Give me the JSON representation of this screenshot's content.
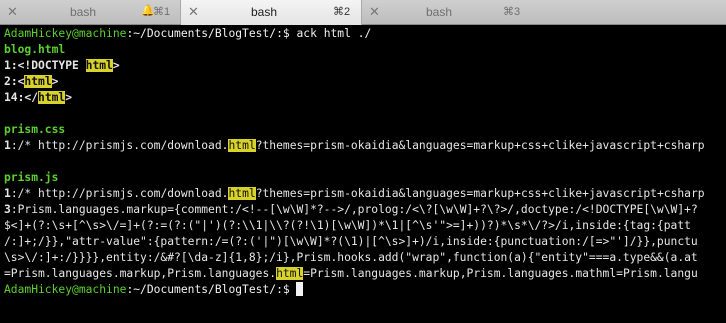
{
  "tabs": [
    {
      "close": "✕",
      "title": "bash",
      "bell": "🔔",
      "shortcut": "⌘1"
    },
    {
      "close": "✕",
      "title": "bash",
      "shortcut": "⌘2"
    },
    {
      "close": "✕",
      "title": "bash",
      "shortcut": "⌘3"
    }
  ],
  "terminal": {
    "prompt_user": "AdamHickey@machine",
    "prompt_path": ":~/Documents/BlogTest/:",
    "prompt_symbol": "$",
    "command": " ack html ./",
    "blog_file": "blog.html",
    "blog_l1_num": "1",
    "blog_l1_pre": ":<!DOCTYPE ",
    "blog_l1_match": "html",
    "blog_l1_post": ">",
    "blog_l2_num": "2",
    "blog_l2_pre": ":<",
    "blog_l2_match": "html",
    "blog_l2_post": ">",
    "blog_l3_num": "14",
    "blog_l3_pre": ":</",
    "blog_l3_match": "html",
    "blog_l3_post": ">",
    "prismcss_file": "prism.css",
    "prismcss_num": "1",
    "prismcss_pre": ":/* http://prismjs.com/download.",
    "prismcss_match": "html",
    "prismcss_post": "?themes=prism-okaidia&languages=markup+css+clike+javascript+csharp",
    "prismjs_file": "prism.js",
    "prismjs_l1_num": "1",
    "prismjs_l1_pre": ":/* http://prismjs.com/download.",
    "prismjs_l1_match": "html",
    "prismjs_l1_post": "?themes=prism-okaidia&languages=markup+css+clike+javascript+csharp",
    "prismjs_l3_num": "3",
    "prismjs_l3_text": ":Prism.languages.markup={comment:/<!--[\\w\\W]*?-->/,prolog:/<\\?[\\w\\W]+?\\?>/,doctype:/<!DOCTYPE[\\w\\W]+?",
    "wrap_1": "$<]+(?:\\s+[^\\s>\\/=]+(?:=(?:(\"|')(?:\\\\1|\\\\?(?!\\1)[\\w\\W])*\\1|[^\\s'\">=]+))?)*\\s*\\/?>/i,inside:{tag:{patt",
    "wrap_2": "/:]+;/}},\"attr-value\":{pattern:/=(?:('|\")[\\w\\W]*?(\\1)|[^\\s>]+)/i,inside:{punctuation:/[=>\"']/}},punctu",
    "wrap_3": "\\s>\\/:]+:/}}}},entity:/&#?[\\da-z]{1,8};/i},Prism.hooks.add(\"wrap\",function(a){\"entity\"===a.type&&(a.at",
    "wrap_4_pre": "=Prism.languages.markup,Prism.languages.",
    "wrap_4_match": "html",
    "wrap_4_post": "=Prism.languages.markup,Prism.languages.mathml=Prism.langu",
    "final_prompt_user": "AdamHickey@machine",
    "final_prompt_path": ":~/Documents/BlogTest/:",
    "final_prompt_symbol": "$ "
  }
}
